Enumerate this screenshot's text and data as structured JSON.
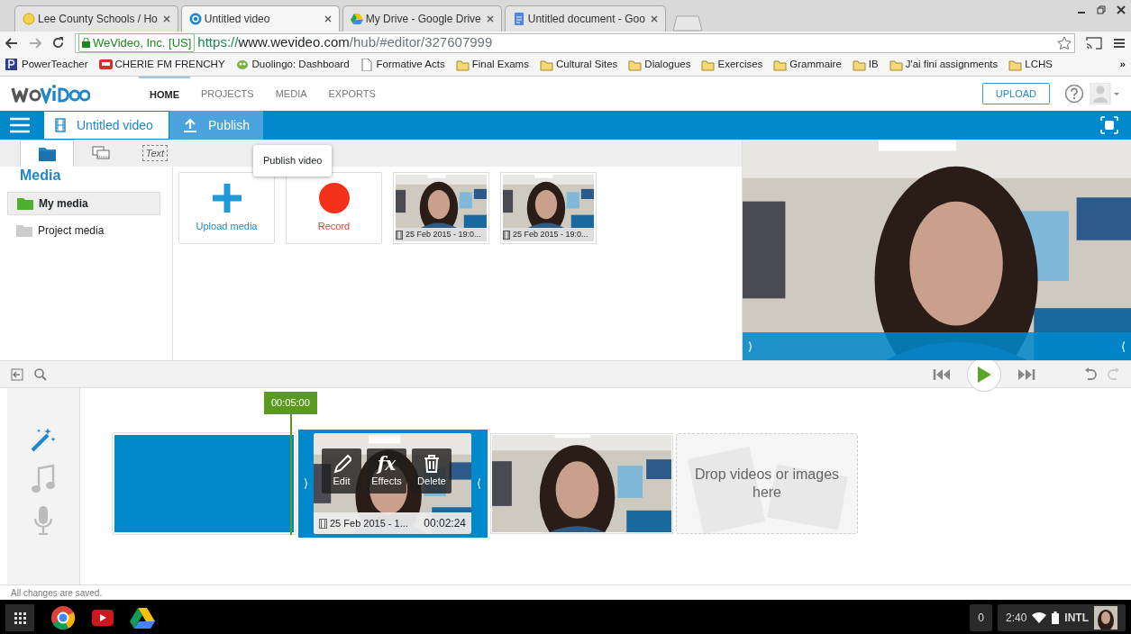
{
  "browser": {
    "tabs": [
      {
        "title": "Lee County Schools / Ho",
        "selected": false
      },
      {
        "title": "Untitled video",
        "selected": true
      },
      {
        "title": "My Drive - Google Drive",
        "selected": false
      },
      {
        "title": "Untitled document - Goo",
        "selected": false
      }
    ],
    "secure_label": "WeVideo, Inc. [US]",
    "url_scheme": "https://",
    "url_host": "www.wevideo.com",
    "url_path": "/hub/#editor/327607999",
    "bookmarks": [
      {
        "label": "PowerTeacher",
        "kind": "powerteacher"
      },
      {
        "label": "CHERIE FM FRENCHY",
        "kind": "radio"
      },
      {
        "label": "Duolingo: Dashboard",
        "kind": "owl"
      },
      {
        "label": "Formative Acts",
        "kind": "page"
      },
      {
        "label": "Final Exams",
        "kind": "folder"
      },
      {
        "label": "Cultural Sites",
        "kind": "folder"
      },
      {
        "label": "Dialogues",
        "kind": "folder"
      },
      {
        "label": "Exercises",
        "kind": "folder"
      },
      {
        "label": "Grammaire",
        "kind": "folder"
      },
      {
        "label": "IB",
        "kind": "folder"
      },
      {
        "label": "J'ai fini assignments",
        "kind": "folder"
      },
      {
        "label": "LCHS",
        "kind": "folder"
      }
    ],
    "more": "»"
  },
  "app": {
    "nav": [
      {
        "label": "HOME",
        "selected": true
      },
      {
        "label": "PROJECTS",
        "selected": false
      },
      {
        "label": "MEDIA",
        "selected": false
      },
      {
        "label": "EXPORTS",
        "selected": false
      }
    ],
    "upload_button": "UPLOAD",
    "project_title": "Untitled video",
    "publish_button": "Publish",
    "tooltip": "Publish video",
    "media_tabs": [
      {
        "kind": "media",
        "selected": true
      },
      {
        "kind": "transitions",
        "selected": false
      },
      {
        "kind": "text",
        "label": "Text",
        "selected": false
      }
    ],
    "panel_title": "Media",
    "folders": [
      {
        "label": "My media",
        "selected": true
      },
      {
        "label": "Project media",
        "selected": false
      }
    ],
    "tiles": [
      {
        "kind": "upload",
        "label": "Upload media"
      },
      {
        "kind": "record",
        "label": "Record"
      },
      {
        "kind": "clip",
        "label": "25 Feb 2015 - 19:0..."
      },
      {
        "kind": "clip",
        "label": "25 Feb 2015 - 19:0..."
      }
    ],
    "preview_left_handle": "⟩",
    "preview_right_handle": "⟨"
  },
  "timeline": {
    "playhead_time": "00:05:00",
    "clips": [
      {
        "kind": "blank"
      },
      {
        "kind": "video",
        "selected": true,
        "caption": "25 Feb 2015 - 1...",
        "duration": "00:02:24",
        "left_handle": "⟩",
        "right_handle": "⟨",
        "actions": [
          {
            "kind": "edit",
            "label": "Edit"
          },
          {
            "kind": "effects",
            "label": "Effects",
            "glyph": "fx"
          },
          {
            "kind": "delete",
            "label": "Delete"
          }
        ]
      },
      {
        "kind": "video",
        "selected": false
      },
      {
        "kind": "drop",
        "text": "Drop videos or images here"
      }
    ]
  },
  "status_bar": "All changes are saved.",
  "taskbar": {
    "notifications": "0",
    "time": "2:40",
    "input_method": "INTL"
  }
}
